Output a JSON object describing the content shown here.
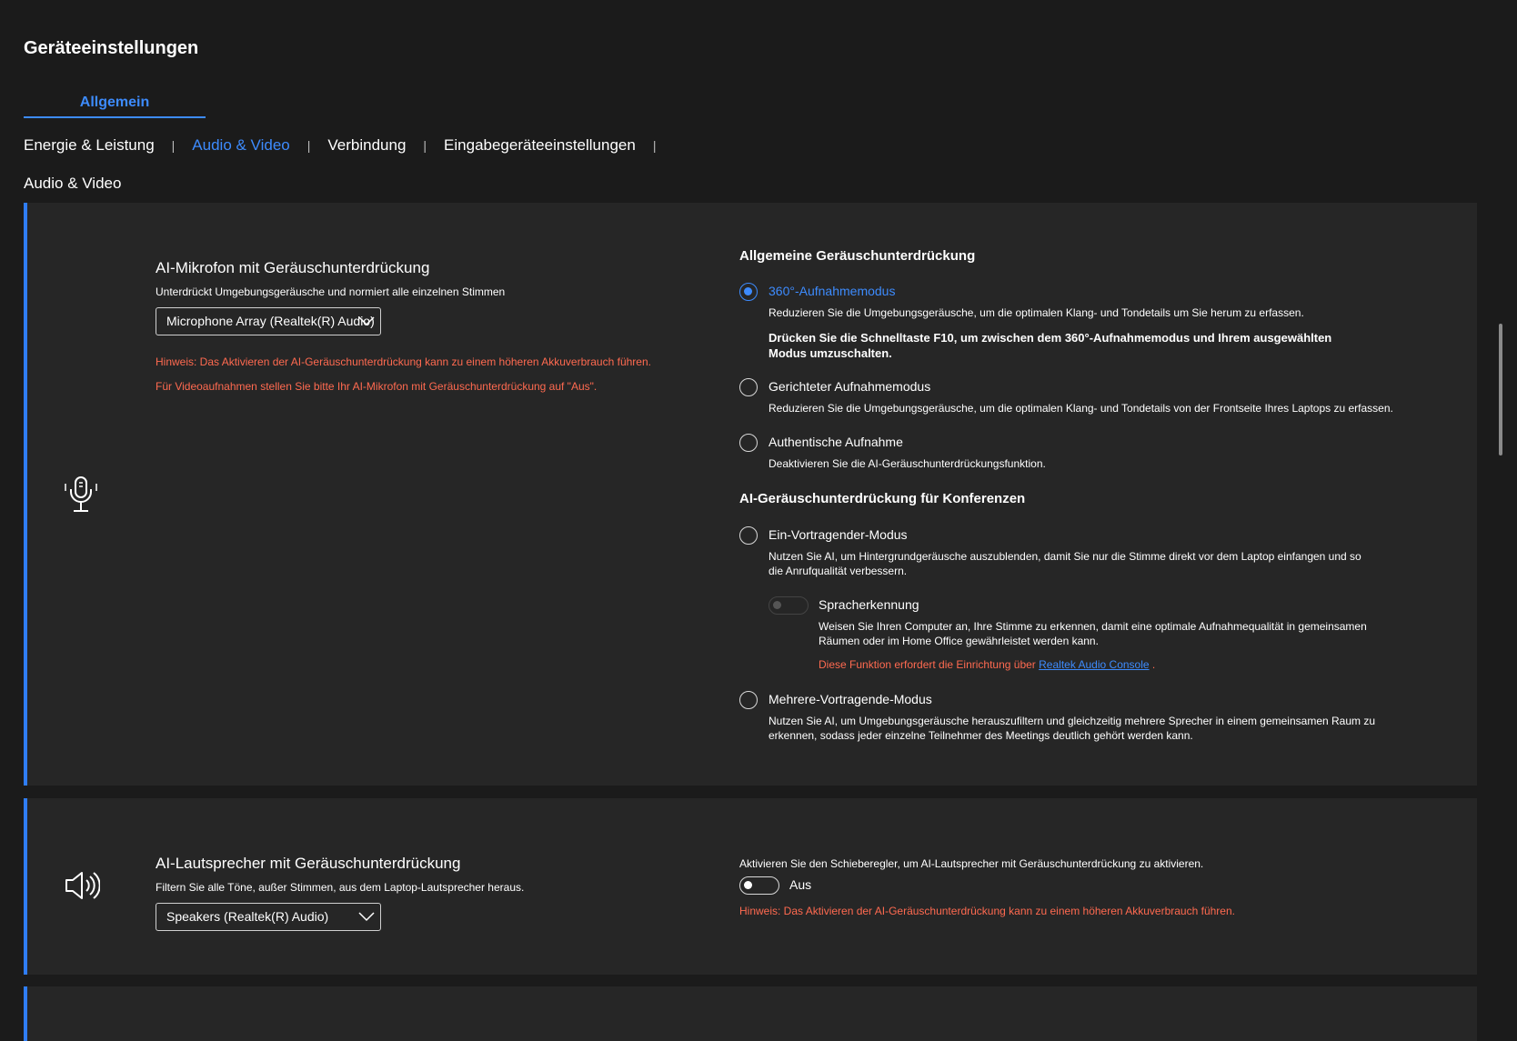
{
  "page": {
    "title": "Geräteeinstellungen"
  },
  "tabs": {
    "general": "Allgemein"
  },
  "subnav": {
    "items": [
      "Energie & Leistung",
      "Audio & Video",
      "Verbindung",
      "Eingabegeräteeinstellungen"
    ],
    "separator": "|",
    "active": "Audio & Video"
  },
  "section": {
    "label": "Audio & Video"
  },
  "mic": {
    "icon": "microphone-icon",
    "title": "AI-Mikrofon mit Geräuschunterdrückung",
    "description": "Unterdrückt Umgebungsgeräusche und normiert alle einzelnen Stimmen",
    "device": "Microphone Array (Realtek(R) Audio)",
    "warning1": "Hinweis: Das Aktivieren der AI-Geräuschunterdrückung kann zu einem höheren Akkuverbrauch führen.",
    "warning2": "Für Videoaufnahmen stellen Sie bitte Ihr AI-Mikrofon mit Geräuschunterdrückung auf \"Aus\".",
    "general_heading": "Allgemeine Geräuschunterdrückung",
    "opt360": {
      "label": "360°-Aufnahmemodus",
      "desc": "Reduzieren Sie die Umgebungsgeräusche, um die optimalen Klang- und Tondetails um Sie herum zu erfassen.",
      "bold": "Drücken Sie die Schnelltaste F10, um zwischen dem 360°-Aufnahmemodus und Ihrem ausgewählten Modus umzuschalten.",
      "selected": true
    },
    "opt_directional": {
      "label": "Gerichteter Aufnahmemodus",
      "desc": "Reduzieren Sie die Umgebungsgeräusche, um die optimalen Klang- und Tondetails von der Frontseite Ihres Laptops zu erfassen."
    },
    "opt_authentic": {
      "label": "Authentische Aufnahme",
      "desc": "Deaktivieren Sie die AI-Geräuschunterdrückungsfunktion."
    },
    "conference_heading": "AI-Geräuschunterdrückung für Konferenzen",
    "opt_single": {
      "label": "Ein-Vortragender-Modus",
      "desc": "Nutzen Sie AI, um Hintergrundgeräusche auszublenden, damit Sie nur die Stimme direkt vor dem Laptop einfangen und so die Anrufqualität verbessern."
    },
    "voice_rec": {
      "label": "Spracherkennung",
      "desc": "Weisen Sie Ihren Computer an, Ihre Stimme zu erkennen, damit eine optimale Aufnahmequalität in gemeinsamen Räumen oder im Home Office gewährleistet werden kann.",
      "note_prefix": "Diese Funktion erfordert die Einrichtung über",
      "note_link": "Realtek Audio Console",
      "note_suffix": "."
    },
    "opt_multi": {
      "label": "Mehrere-Vortragende-Modus",
      "desc": "Nutzen Sie AI, um Umgebungsgeräusche herauszufiltern und gleichzeitig mehrere Sprecher in einem gemeinsamen Raum zu erkennen, sodass jeder einzelne Teilnehmer des Meetings deutlich gehört werden kann."
    }
  },
  "speaker": {
    "icon": "speaker-icon",
    "title": "AI-Lautsprecher mit Geräuschunterdrückung",
    "description": "Filtern Sie alle Töne, außer Stimmen, aus dem Laptop-Lautsprecher heraus.",
    "device": "Speakers (Realtek(R) Audio)",
    "toggle_hint": "Aktivieren Sie den Schieberegler, um AI-Lautsprecher mit Geräuschunterdrückung zu aktivieren.",
    "toggle_state": "Aus",
    "warning": "Hinweis: Das Aktivieren der AI-Geräuschunterdrückung kann zu einem höheren Akkuverbrauch führen."
  },
  "colors": {
    "accent": "#3d8bfd",
    "warning": "#ff6a50",
    "background": "#1b1b1b",
    "card": "#262626"
  }
}
